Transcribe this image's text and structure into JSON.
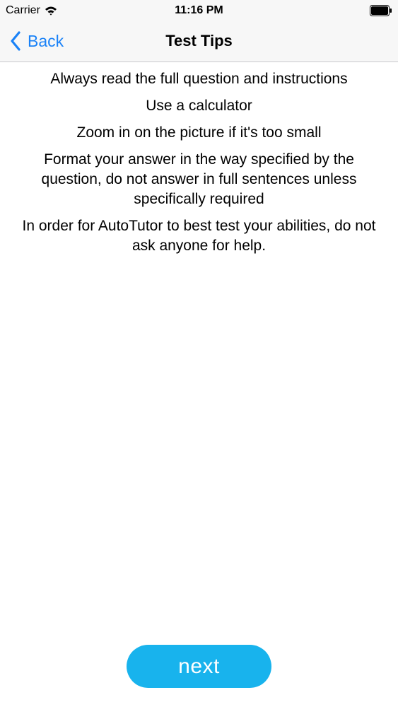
{
  "status_bar": {
    "carrier": "Carrier",
    "time": "11:16 PM"
  },
  "nav": {
    "back_label": "Back",
    "title": "Test Tips"
  },
  "tips": [
    "Always read the full question and instructions",
    "Use a calculator",
    "Zoom in on the picture if it's too small",
    "Format your answer in the way specified by the question, do not answer in full sentences unless specifically required",
    "In order for AutoTutor to best test your abilities, do not ask anyone for help."
  ],
  "next_label": "next",
  "colors": {
    "accent": "#1a82f7",
    "button": "#18b3ed",
    "bar_background": "#f7f7f7"
  }
}
